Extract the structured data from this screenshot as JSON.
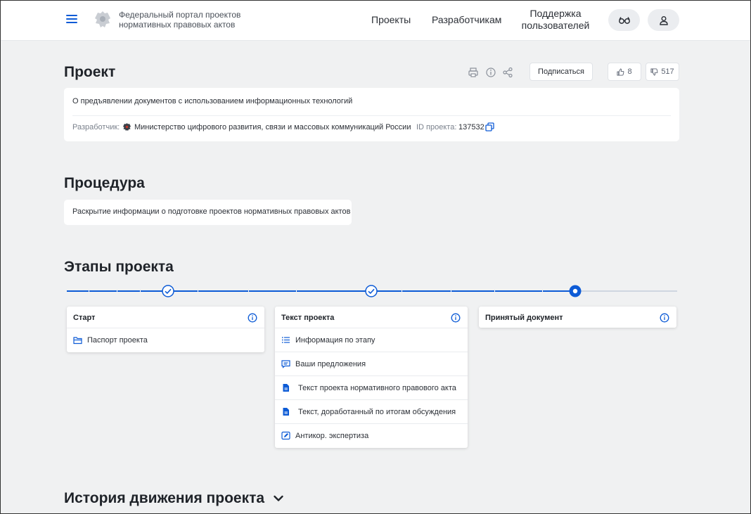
{
  "header": {
    "portal_name": "Федеральный портал проектов нормативных правовых актов",
    "nav": {
      "projects": "Проекты",
      "developers": "Разработчикам",
      "support": "Поддержка пользователей"
    }
  },
  "project": {
    "title": "Проект",
    "subscribe_label": "Подписаться",
    "likes": "8",
    "dislikes": "517",
    "name": "О предъявлении документов с использованием информационных технологий",
    "developer_label": "Разработчик:",
    "developer": "Министерство цифрового развития, связи и массовых коммуникаций России",
    "id_label": "ID проекта:",
    "id_value": "137532"
  },
  "procedure": {
    "title": "Процедура",
    "text": "Раскрытие информации о подготовке проектов нормативных правовых актов"
  },
  "stages": {
    "title": "Этапы проекта",
    "items": [
      {
        "title": "Старт",
        "status": "completed",
        "links": [
          {
            "label": "Паспорт проекта",
            "icon": "folder-icon"
          }
        ]
      },
      {
        "title": "Текст проекта",
        "status": "completed",
        "links": [
          {
            "label": "Информация по этапу",
            "icon": "list-icon"
          },
          {
            "label": "Ваши предложения",
            "icon": "comment-icon"
          },
          {
            "label": "Текст проекта нормативного правового акта",
            "icon": "document-icon"
          },
          {
            "label": "Текст, доработанный по итогам обсуждения",
            "icon": "document-icon"
          },
          {
            "label": "Антикор. экспертиза",
            "icon": "edit-icon"
          }
        ]
      },
      {
        "title": "Принятый документ",
        "status": "current",
        "links": []
      }
    ]
  },
  "history": {
    "title": "История движения проекта"
  },
  "colors": {
    "accent": "#0d5bd6",
    "background": "#f0f1f2",
    "card": "#ffffff"
  }
}
